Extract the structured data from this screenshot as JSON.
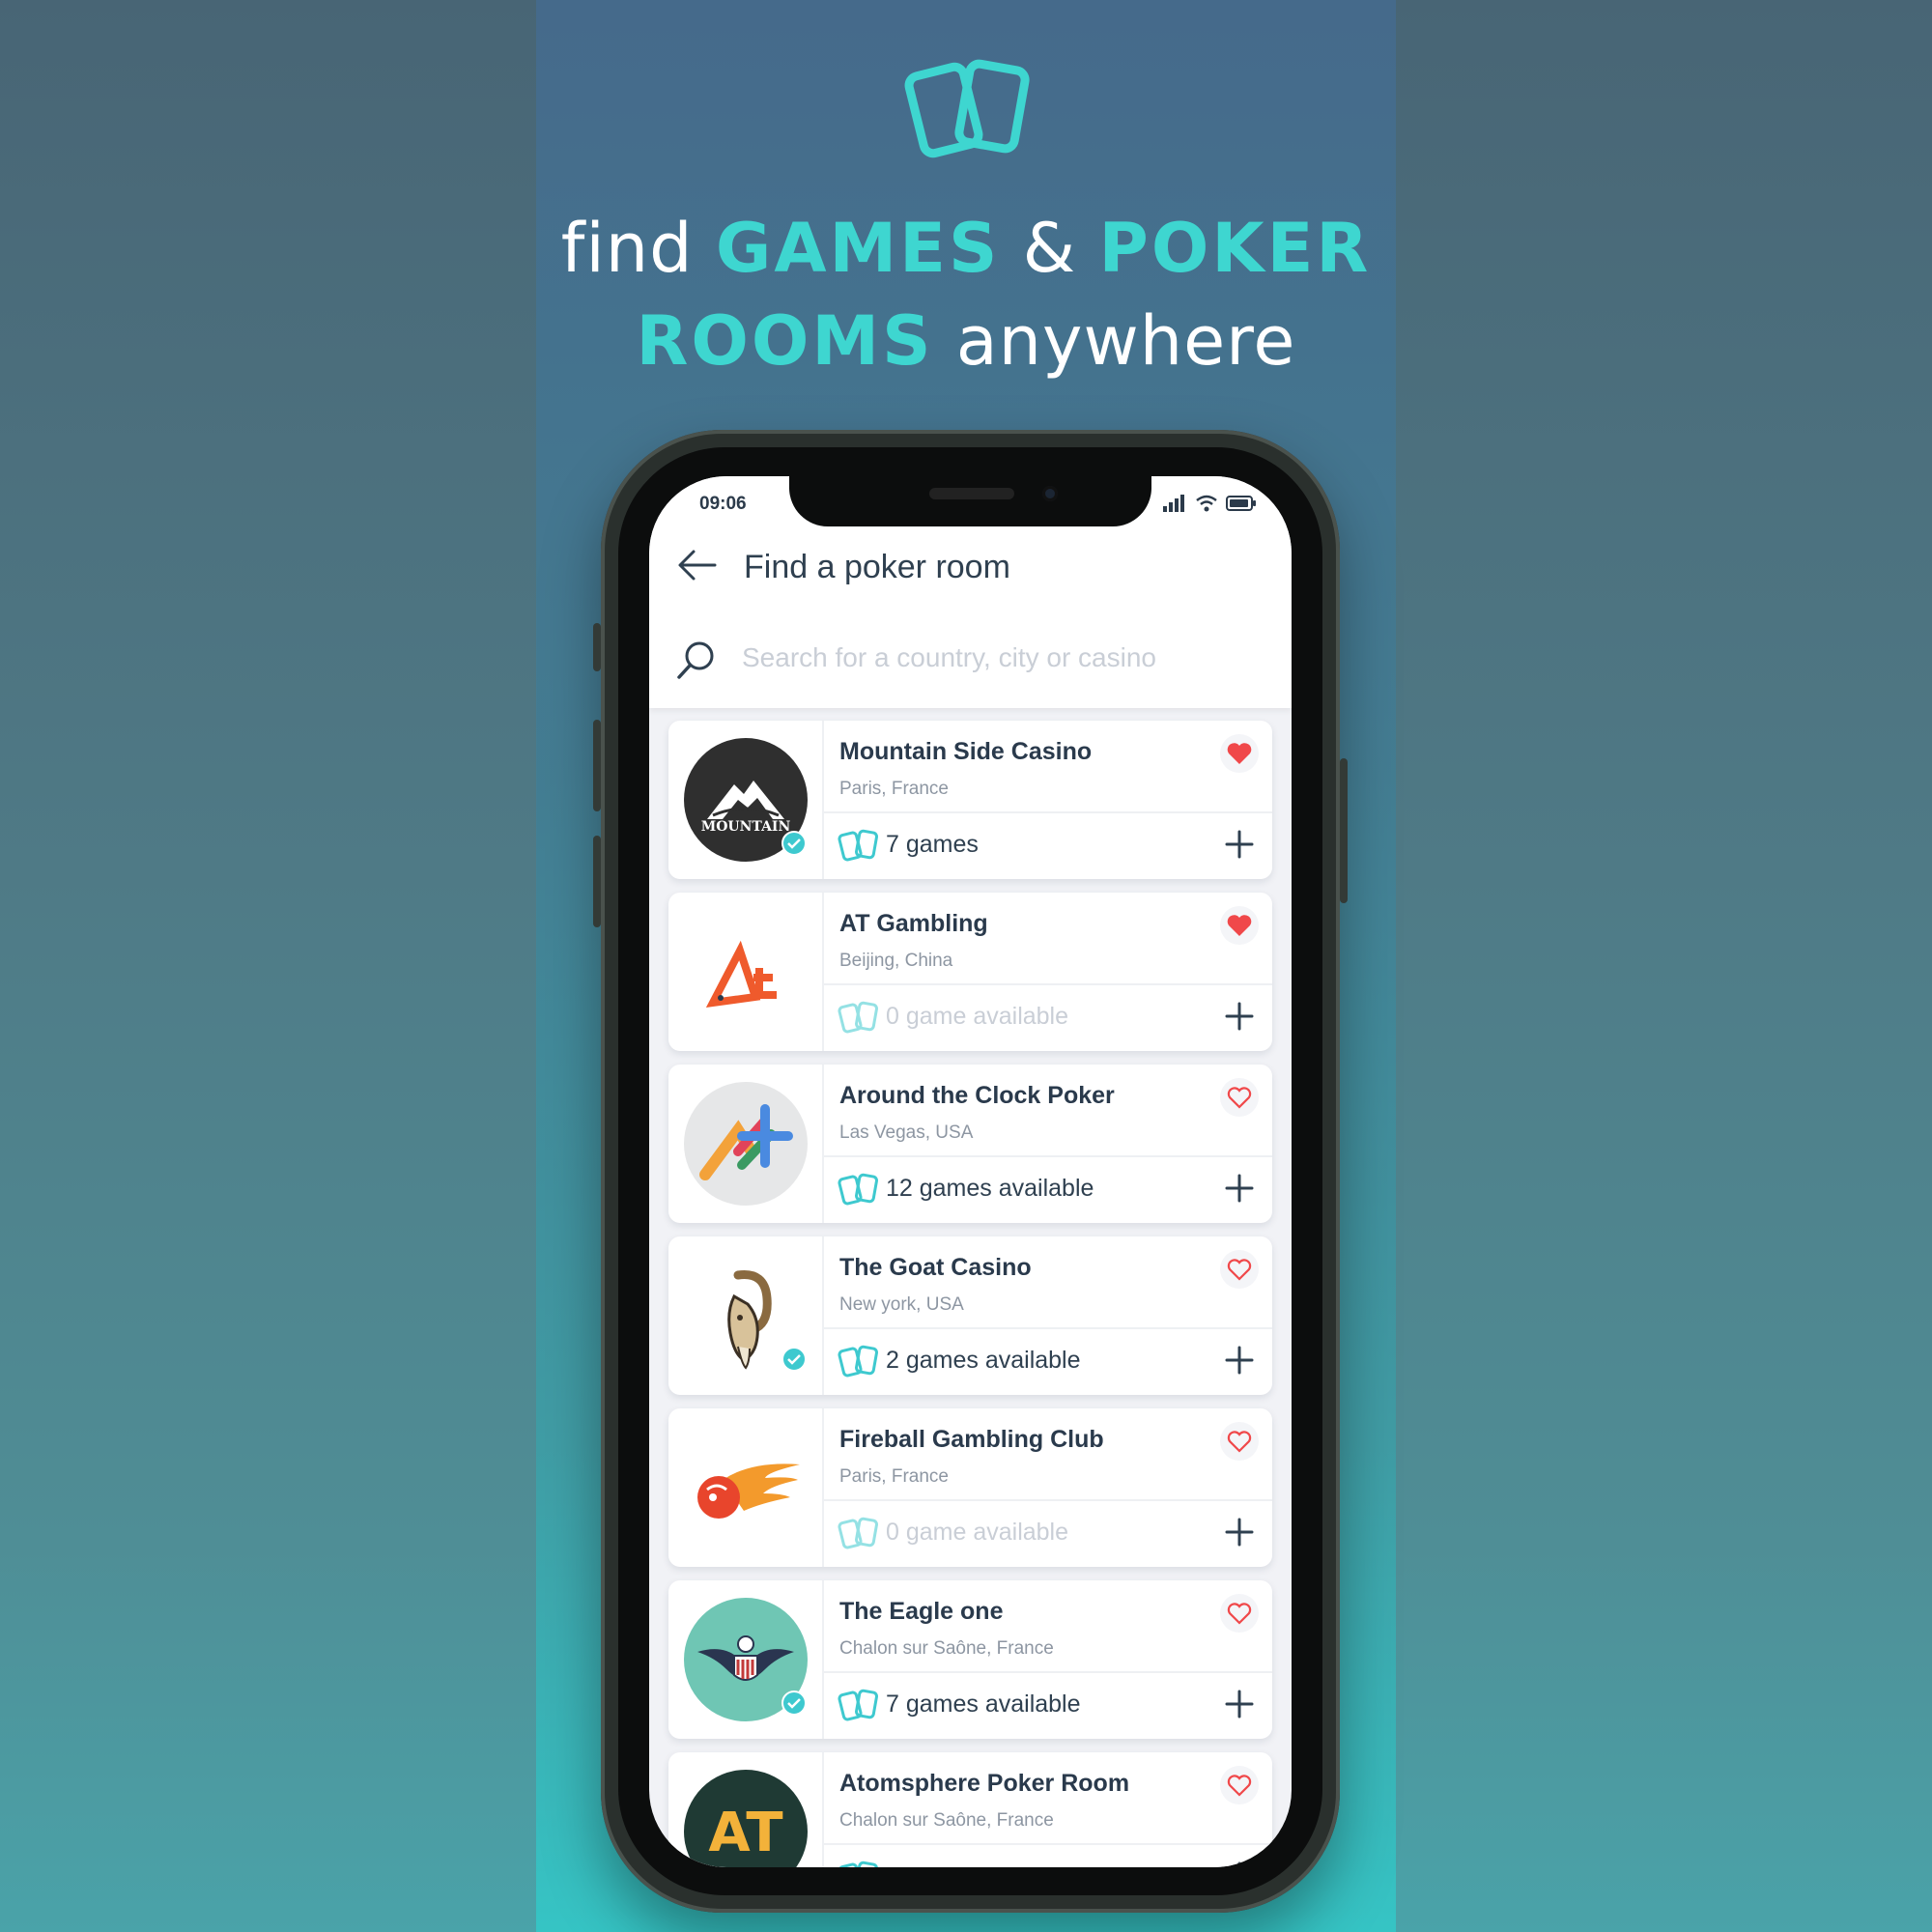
{
  "promo": {
    "line1_prefix": "find",
    "line1_highlight1": "GAMES",
    "line1_amp": "&",
    "line1_highlight2": "POKER",
    "line2_highlight": "ROOMS",
    "line2_suffix": "anywhere",
    "logo_icon": "cards-icon"
  },
  "colors": {
    "accent": "#3ed6d0",
    "heart_active": "#f0484a",
    "text_dark": "#2a3a4c",
    "text_muted": "#8d96a2",
    "placeholder": "#c9ced6"
  },
  "status_bar": {
    "time": "09:06"
  },
  "header": {
    "title": "Find a poker room"
  },
  "search": {
    "placeholder": "Search for a country, city or casino",
    "value": ""
  },
  "rooms": [
    {
      "name": "Mountain Side Casino",
      "location": "Paris, France",
      "games": "7 games",
      "favorite": true,
      "verified": true,
      "logo_text": "MOUNTAIN"
    },
    {
      "name": "AT Gambling",
      "location": "Beijing, China",
      "games": "0 game available",
      "favorite": true,
      "verified": false
    },
    {
      "name": "Around the Clock Poker",
      "location": "Las Vegas, USA",
      "games": "12 games available",
      "favorite": false,
      "verified": false
    },
    {
      "name": "The Goat Casino",
      "location": "New york, USA",
      "games": "2 games available",
      "favorite": false,
      "verified": true
    },
    {
      "name": "Fireball Gambling Club",
      "location": "Paris, France",
      "games": "0 game available",
      "favorite": false,
      "verified": false
    },
    {
      "name": "The Eagle one",
      "location": "Chalon sur Saône, France",
      "games": "7 games available",
      "favorite": false,
      "verified": true
    },
    {
      "name": "Atomsphere Poker Room",
      "location": "Chalon sur Saône, France",
      "games": "",
      "favorite": false,
      "verified": false,
      "logo_text": "AT"
    }
  ]
}
